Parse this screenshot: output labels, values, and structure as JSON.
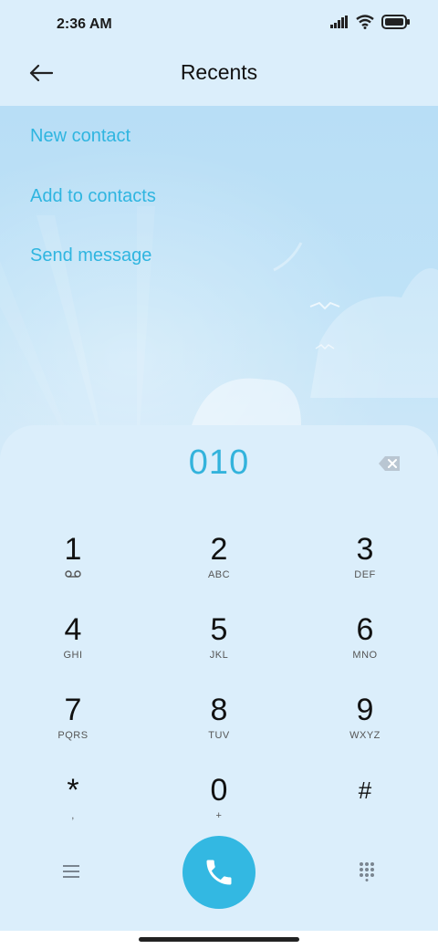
{
  "status": {
    "time": "2:36 AM",
    "icons": [
      "signal-icon",
      "wifi-icon",
      "battery-icon"
    ]
  },
  "header": {
    "title": "Recents",
    "back_icon": "arrow-left-icon"
  },
  "actions": [
    {
      "label": "New contact"
    },
    {
      "label": "Add to contacts"
    },
    {
      "label": "Send message"
    }
  ],
  "dialer": {
    "number": "010",
    "keys": [
      {
        "digit": "1",
        "letters": ""
      },
      {
        "digit": "2",
        "letters": "ABC"
      },
      {
        "digit": "3",
        "letters": "DEF"
      },
      {
        "digit": "4",
        "letters": "GHI"
      },
      {
        "digit": "5",
        "letters": "JKL"
      },
      {
        "digit": "6",
        "letters": "MNO"
      },
      {
        "digit": "7",
        "letters": "PQRS"
      },
      {
        "digit": "8",
        "letters": "TUV"
      },
      {
        "digit": "9",
        "letters": "WXYZ"
      },
      {
        "digit": "*",
        "letters": ","
      },
      {
        "digit": "0",
        "letters": "+"
      },
      {
        "digit": "#",
        "letters": ""
      }
    ]
  },
  "colors": {
    "accent": "#33b8e2",
    "background": "#dbeefb",
    "sky": "#b8def6"
  }
}
